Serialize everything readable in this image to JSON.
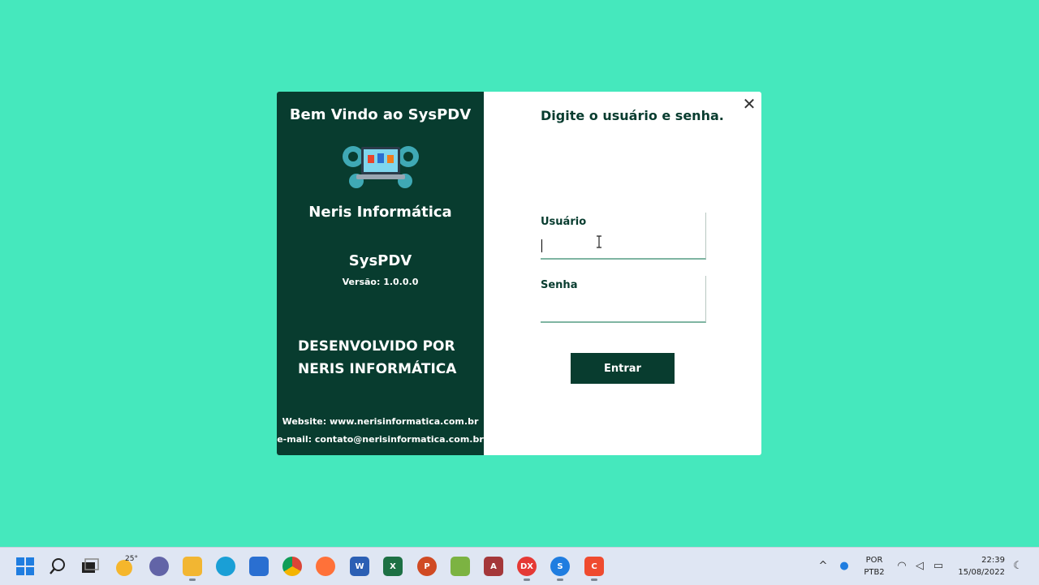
{
  "login": {
    "welcome": "Bem Vindo ao SysPDV",
    "company": "Neris Informática",
    "app_name": "SysPDV",
    "version": "Versão: 1.0.0.0",
    "developed_by": "DESENVOLVIDO POR NERIS INFORMÁTICA",
    "website": "Website: www.nerisinformatica.com.br",
    "email": "e-mail: contato@nerisinformatica.com.br",
    "prompt": "Digite o usuário e senha.",
    "user_label": "Usuário",
    "user_value": "",
    "password_label": "Senha",
    "password_value": "",
    "enter_label": "Entrar",
    "close_symbol": "✕"
  },
  "taskbar": {
    "weather_temp": "25°",
    "language_top": "POR",
    "language_bottom": "PTB2",
    "time": "22:39",
    "date": "15/08/2022",
    "apps": [
      "start-icon",
      "search-icon",
      "task-view-icon",
      "weather-icon",
      "teams-chat-icon",
      "file-explorer-icon",
      "edge-icon",
      "store-icon",
      "chrome-icon",
      "firefox-icon",
      "word-icon",
      "excel-icon",
      "powerpoint-icon",
      "project-icon",
      "access-icon",
      "devexpress-icon",
      "app-s-icon",
      "app-c-icon"
    ],
    "dx_label": "DX",
    "word_label": "W",
    "excel_label": "X",
    "ppt_label": "P",
    "access_label": "A",
    "s_label": "S",
    "c_label": "C"
  },
  "colors": {
    "background": "#45e8bd",
    "panel": "#083c2f",
    "accent": "#083c2f"
  }
}
